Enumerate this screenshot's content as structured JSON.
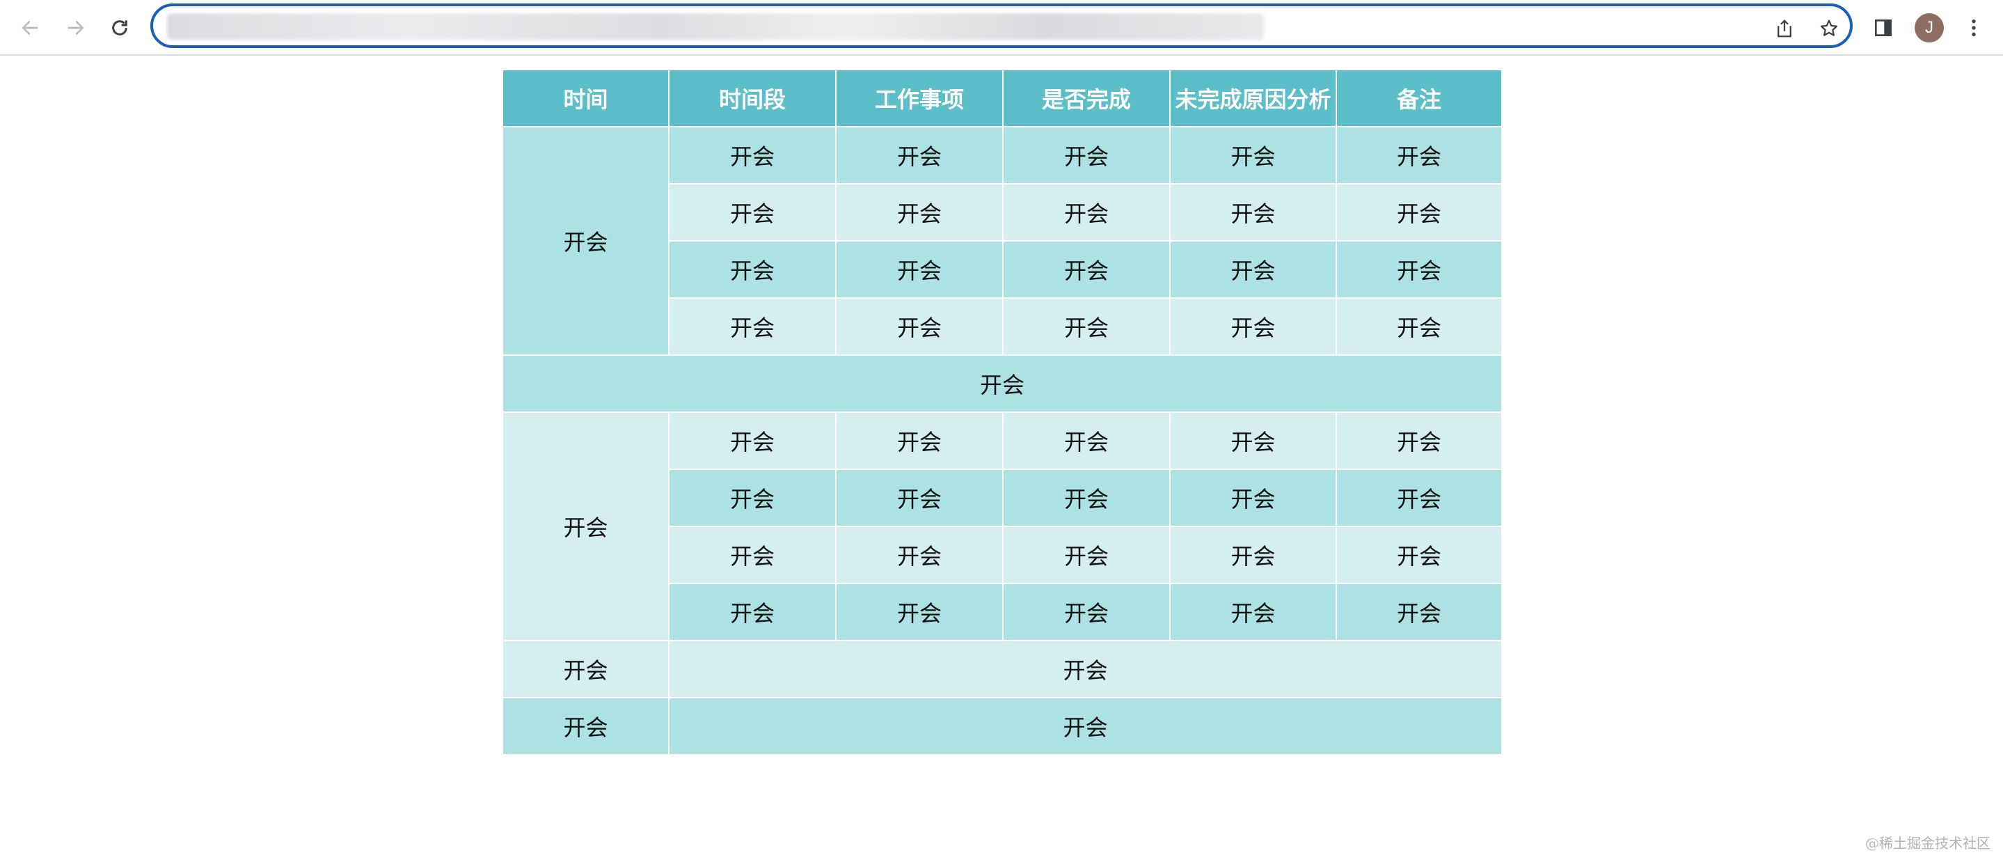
{
  "browser": {
    "icons": {
      "back": "arrow-left-icon",
      "forward": "arrow-right-icon",
      "reload": "reload-icon",
      "share": "share-icon",
      "bookmark": "star-icon",
      "side_panel": "side-panel-icon",
      "menu": "kebab-menu-icon"
    },
    "profile_initial": "J",
    "colors": {
      "omnibox_border": "#1a5fb4",
      "avatar_bg": "#8d6e63",
      "icon": "#5f6368",
      "icon_disabled": "#b8bbbf"
    }
  },
  "table": {
    "colors": {
      "header": "#5bbec8",
      "row_dark": "#ace2e4",
      "row_light": "#d5eff1"
    },
    "headers": [
      "时间",
      "时间段",
      "工作事项",
      "是否完成",
      "未完成原因分析",
      "备注"
    ],
    "group1": {
      "label": "开会",
      "rows": [
        [
          "开会",
          "开会",
          "开会",
          "开会",
          "开会"
        ],
        [
          "开会",
          "开会",
          "开会",
          "开会",
          "开会"
        ],
        [
          "开会",
          "开会",
          "开会",
          "开会",
          "开会"
        ],
        [
          "开会",
          "开会",
          "开会",
          "开会",
          "开会"
        ]
      ]
    },
    "full_row": "开会",
    "group2": {
      "label": "开会",
      "rows": [
        [
          "开会",
          "开会",
          "开会",
          "开会",
          "开会"
        ],
        [
          "开会",
          "开会",
          "开会",
          "开会",
          "开会"
        ],
        [
          "开会",
          "开会",
          "开会",
          "开会",
          "开会"
        ],
        [
          "开会",
          "开会",
          "开会",
          "开会",
          "开会"
        ]
      ]
    },
    "summary_rows": [
      {
        "label": "开会",
        "value": "开会"
      },
      {
        "label": "开会",
        "value": "开会"
      }
    ]
  },
  "watermark": "@稀土掘金技术社区"
}
